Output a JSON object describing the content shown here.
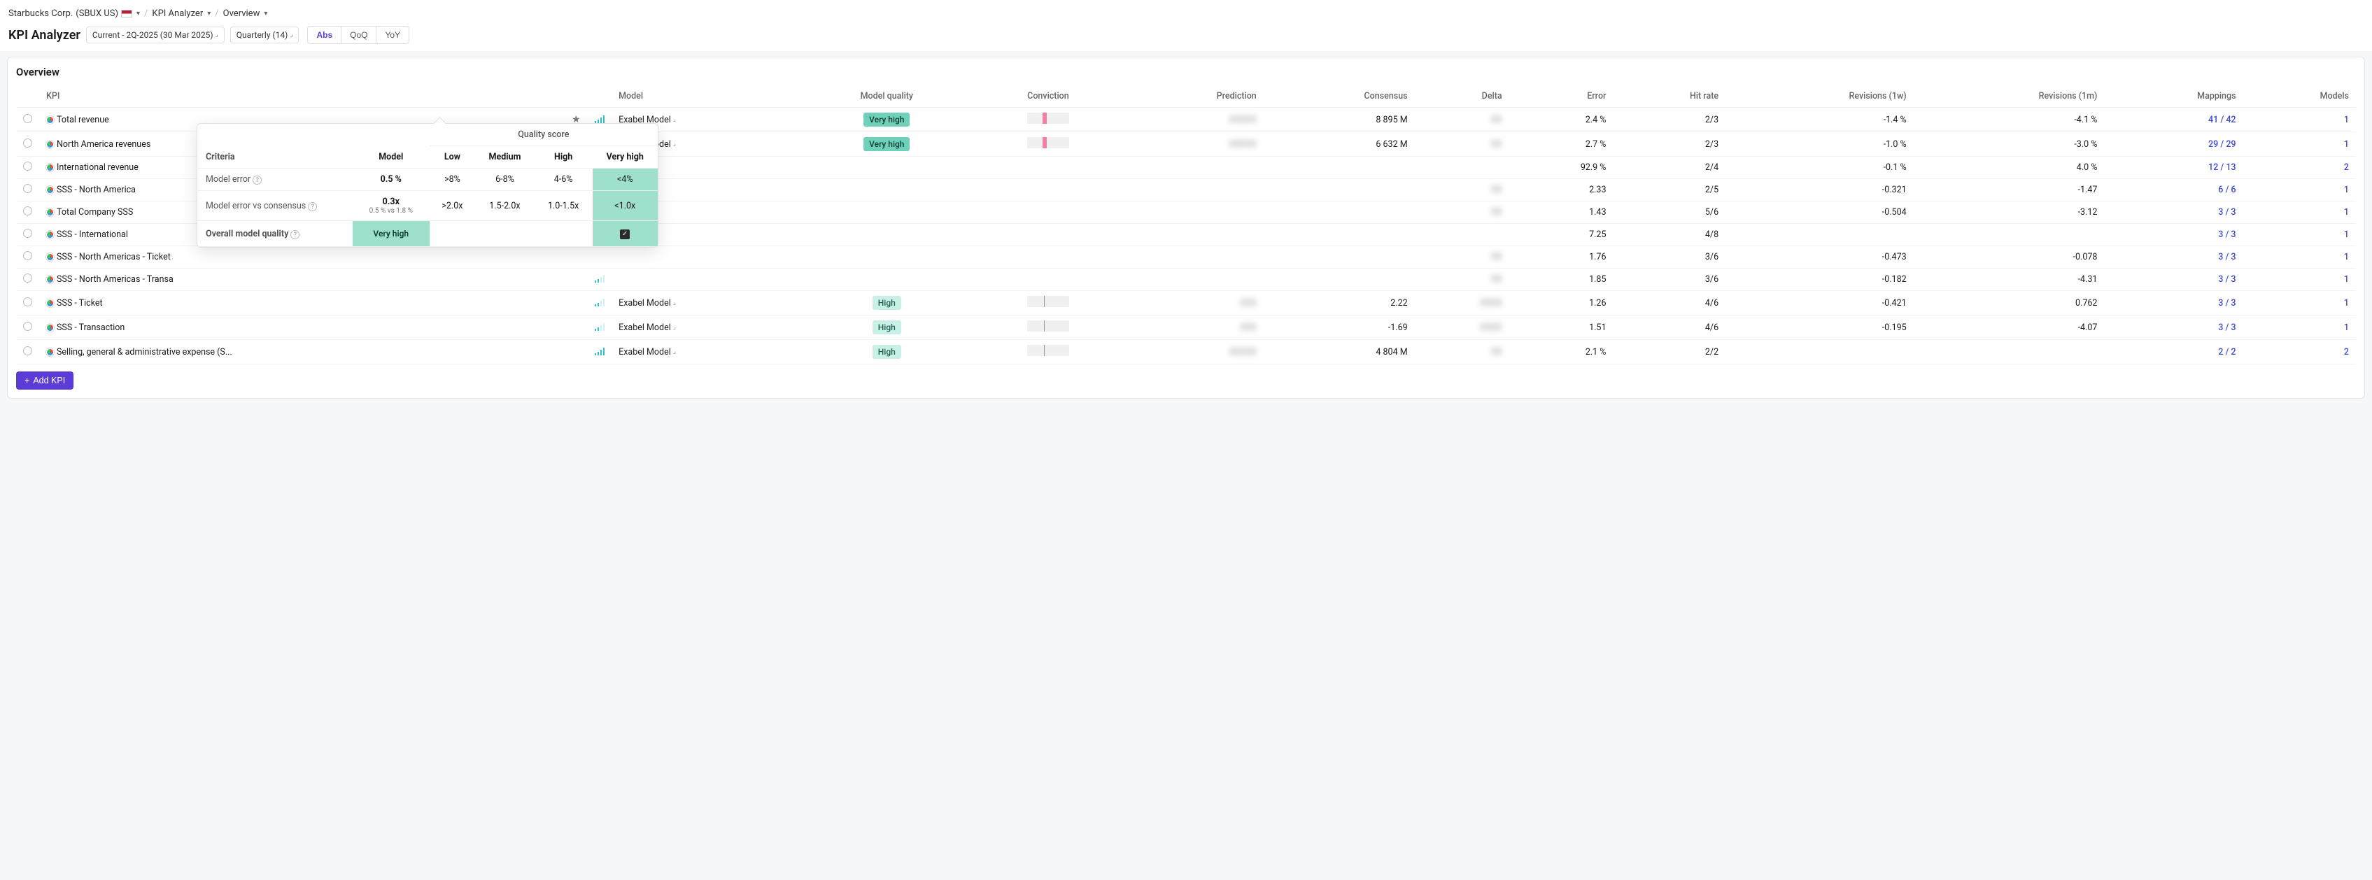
{
  "breadcrumb": {
    "company": "Starbucks Corp.",
    "ticker": "(SBUX US)",
    "app": "KPI Analyzer",
    "view": "Overview"
  },
  "title": "KPI Analyzer",
  "period_pill": "Current - 2Q-2025 (30 Mar 2025)",
  "freq_pill": "Quarterly (14)",
  "seg": {
    "abs": "Abs",
    "qoq": "QoQ",
    "yoy": "YoY"
  },
  "section_title": "Overview",
  "columns": {
    "kpi": "KPI",
    "model": "Model",
    "quality": "Model quality",
    "conviction": "Conviction",
    "prediction": "Prediction",
    "consensus": "Consensus",
    "delta": "Delta",
    "error": "Error",
    "hitrate": "Hit rate",
    "rev1w": "Revisions (1w)",
    "rev1m": "Revisions (1m)",
    "mappings": "Mappings",
    "models": "Models"
  },
  "rows": [
    {
      "name": "Total revenue",
      "starred": true,
      "sig": "full",
      "model": "Exabel Model",
      "quality": "Very high",
      "qclass": "vhigh",
      "conv": true,
      "prediction": "XXXXX",
      "consensus": "8 895 M",
      "delta": "XX",
      "error": "2.4 %",
      "hitrate": "2/3",
      "rev1w": "-1.4 %",
      "rev1m": "-4.1 %",
      "mappings": "41 / 42",
      "models": "1"
    },
    {
      "name": "North America revenues",
      "starred": true,
      "sig": "full",
      "model": "Exabel Model",
      "quality": "Very high",
      "qclass": "vhigh",
      "conv": true,
      "prediction": "XXXXX",
      "consensus": "6 632 M",
      "delta": "XX",
      "error": "2.7 %",
      "hitrate": "2/3",
      "rev1w": "-1.0 %",
      "rev1m": "-3.0 %",
      "mappings": "29 / 29",
      "models": "1"
    },
    {
      "name": "International revenue",
      "starred": false,
      "sig": "",
      "model": "",
      "quality": "",
      "qclass": "",
      "conv": false,
      "prediction": "",
      "consensus": "",
      "delta": "",
      "error": "92.9 %",
      "hitrate": "2/4",
      "rev1w": "-0.1 %",
      "rev1m": "4.0 %",
      "mappings": "12 / 13",
      "models": "2"
    },
    {
      "name": "SSS - North America",
      "starred": false,
      "sig": "",
      "model": "",
      "quality": "",
      "qclass": "",
      "conv": false,
      "prediction": "",
      "consensus": "",
      "delta": "XX",
      "error": "2.33",
      "hitrate": "2/5",
      "rev1w": "-0.321",
      "rev1m": "-1.47",
      "mappings": "6 / 6",
      "models": "1"
    },
    {
      "name": "Total Company SSS",
      "starred": false,
      "sig": "",
      "model": "",
      "quality": "",
      "qclass": "",
      "conv": false,
      "prediction": "",
      "consensus": "",
      "delta": "XX",
      "error": "1.43",
      "hitrate": "5/6",
      "rev1w": "-0.504",
      "rev1m": "-3.12",
      "mappings": "3 / 3",
      "models": "1"
    },
    {
      "name": "SSS - International",
      "starred": false,
      "sig": "",
      "model": "",
      "quality": "",
      "qclass": "",
      "conv": false,
      "prediction": "",
      "consensus": "",
      "delta": "",
      "error": "7.25",
      "hitrate": "4/8",
      "rev1w": "",
      "rev1m": "",
      "mappings": "3 / 3",
      "models": "1"
    },
    {
      "name": "SSS - North Americas - Ticket",
      "starred": false,
      "sig": "",
      "model": "",
      "quality": "",
      "qclass": "",
      "conv": false,
      "prediction": "",
      "consensus": "",
      "delta": "XX",
      "error": "1.76",
      "hitrate": "3/6",
      "rev1w": "-0.473",
      "rev1m": "-0.078",
      "mappings": "3 / 3",
      "models": "1"
    },
    {
      "name": "SSS - North Americas - Transa",
      "starred": false,
      "sig": "weak",
      "model": "",
      "quality": "",
      "qclass": "",
      "conv": false,
      "prediction": "",
      "consensus": "",
      "delta": "XX",
      "error": "1.85",
      "hitrate": "3/6",
      "rev1w": "-0.182",
      "rev1m": "-4.31",
      "mappings": "3 / 3",
      "models": "1"
    },
    {
      "name": "SSS - Ticket",
      "starred": false,
      "sig": "weak",
      "model": "Exabel Model",
      "quality": "High",
      "qclass": "high",
      "conv": false,
      "conv_mid": true,
      "prediction": "XXX",
      "consensus": "2.22",
      "delta": "XXXX",
      "error": "1.26",
      "hitrate": "4/6",
      "rev1w": "-0.421",
      "rev1m": "0.762",
      "mappings": "3 / 3",
      "models": "1"
    },
    {
      "name": "SSS - Transaction",
      "starred": false,
      "sig": "weak",
      "model": "Exabel Model",
      "quality": "High",
      "qclass": "high",
      "conv": false,
      "conv_mid": true,
      "prediction": "XXX",
      "consensus": "-1.69",
      "delta": "XXXX",
      "error": "1.51",
      "hitrate": "4/6",
      "rev1w": "-0.195",
      "rev1m": "-4.07",
      "mappings": "3 / 3",
      "models": "1"
    },
    {
      "name": "Selling, general & administrative expense (S...",
      "starred": false,
      "sig": "full",
      "model": "Exabel Model",
      "quality": "High",
      "qclass": "high",
      "conv": false,
      "conv_mid": true,
      "prediction": "XXXXX",
      "consensus": "4 804 M",
      "delta": "XX",
      "error": "2.1 %",
      "hitrate": "2/2",
      "rev1w": "",
      "rev1m": "",
      "mappings": "2 / 2",
      "models": "2"
    }
  ],
  "add_kpi_label": "Add KPI",
  "tooltip": {
    "group_header": "Quality score",
    "criteria": "Criteria",
    "model": "Model",
    "low": "Low",
    "medium": "Medium",
    "high": "High",
    "vhigh": "Very high",
    "r1_label": "Model error",
    "r1_model": "0.5 %",
    "r1_low": ">8%",
    "r1_med": "6-8%",
    "r1_high": "4-6%",
    "r1_vhigh": "<4%",
    "r2_label": "Model error vs consensus",
    "r2_model": "0.3x",
    "r2_model_sub": "0.5 % vs 1.8 %",
    "r2_low": ">2.0x",
    "r2_med": "1.5-2.0x",
    "r2_high": "1.0-1.5x",
    "r2_vhigh": "<1.0x",
    "r3_label": "Overall model quality",
    "r3_model": "Very high"
  }
}
